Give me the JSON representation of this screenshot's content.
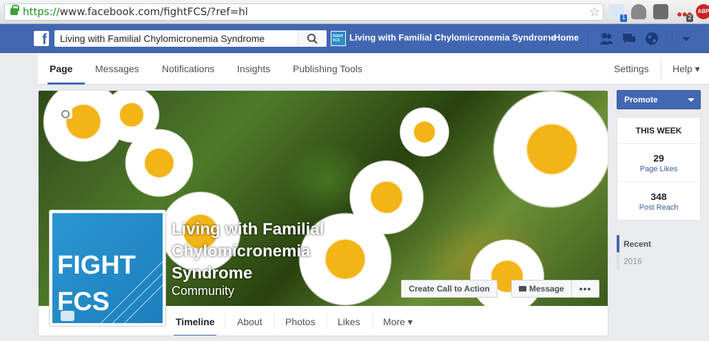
{
  "browser": {
    "url_scheme": "https://",
    "url_rest": "www.facebook.com/fightFCS/?ref=hl",
    "extension_badges": [
      "1",
      "2"
    ],
    "adblock_label": "ABP"
  },
  "fb_bar": {
    "logo": "f",
    "search_value": "Living with Familial Chylomicronemia Syndrome",
    "page_thumb_label": "FIGHT FCS",
    "page_name": "Living with Familial Chylomicronemia Syndrome",
    "home": "Home",
    "icons": [
      "friend-requests-icon",
      "messages-icon",
      "notifications-globe-icon",
      "account-menu-caret-icon"
    ]
  },
  "page_nav": {
    "tabs": [
      "Page",
      "Messages",
      "Notifications",
      "Insights",
      "Publishing Tools"
    ],
    "settings": "Settings",
    "help": "Help ▾"
  },
  "cover": {
    "profile_text_line1": "FIGHT",
    "profile_text_line2": "FCS",
    "title": "Living with Familial Chylomicronemia Syndrome",
    "category": "Community",
    "cta_button": "Create Call to Action",
    "message_button": "Message",
    "more_button": "•••"
  },
  "timeline_nav": {
    "items": [
      "Timeline",
      "About",
      "Photos",
      "Likes",
      "More ▾"
    ]
  },
  "sidebar": {
    "promote": "Promote",
    "this_week_title": "THIS WEEK",
    "stats": [
      {
        "value": "29",
        "label": "Page Likes"
      },
      {
        "value": "348",
        "label": "Post Reach"
      }
    ],
    "years": [
      "Recent",
      "2016"
    ]
  },
  "colors": {
    "fb_blue": "#4267b2",
    "link": "#365899",
    "page_bg": "#e9ebee"
  }
}
